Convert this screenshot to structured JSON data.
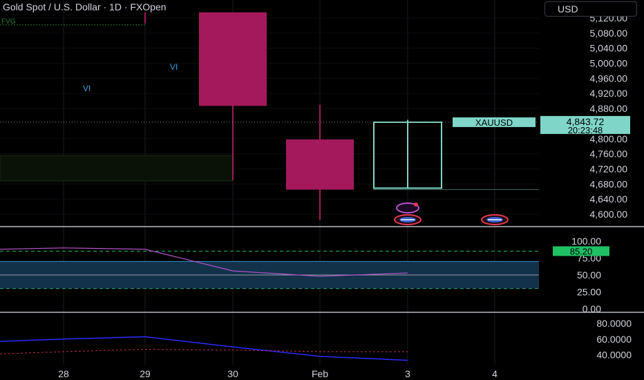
{
  "header": {
    "title": "Gold Spot / U.S. Dollar · 1D · FXOpen",
    "currency": "USD",
    "fvg_label": "FVG"
  },
  "colors": {
    "background": "#000000",
    "bear_candle": "#a3195b",
    "bull_candle_outline": "#7fd6c8",
    "rsi_line": "#b455c9",
    "rsi_band": "#12324a",
    "rsi_level": "#20c065",
    "second_line": "#2b2bff",
    "second_dashed": "#c0304a",
    "text": "#d1d4dc",
    "grid": "#1a1c22"
  },
  "chart_data": [
    {
      "type": "candlestick",
      "title": "Gold Spot / U.S. Dollar · 1D · FXOpen",
      "symbol": "XAUUSD",
      "x_ticks": [
        "28",
        "29",
        "30",
        "Feb",
        "3",
        "4"
      ],
      "y_ticks": [
        "5,120.00",
        "5,080.00",
        "5,040.00",
        "5,000.00",
        "4,960.00",
        "4,920.00",
        "4,880.00",
        "4,800.00",
        "4,760.00",
        "4,720.00",
        "4,680.00",
        "4,640.00",
        "4,600.00"
      ],
      "ylim": [
        4585,
        5135
      ],
      "candles": [
        {
          "x": "29",
          "open": 5135,
          "high": 5135,
          "low": 5105,
          "close": 5105,
          "direction": "down"
        },
        {
          "x": "30",
          "open": 5135,
          "high": 5135,
          "low": 4690,
          "close": 4887,
          "direction": "down"
        },
        {
          "x": "Feb",
          "open": 4798,
          "high": 4890,
          "low": 4585,
          "close": 4665,
          "direction": "down"
        },
        {
          "x": "3",
          "open": 4669,
          "high": 4850,
          "low": 4669,
          "close": 4843.72,
          "direction": "up"
        }
      ],
      "last_price": {
        "label": "XAUUSD",
        "price": "4,843.72",
        "countdown": "20:23:48"
      },
      "annotations": [
        {
          "text": "VI",
          "x": "28"
        },
        {
          "text": "VI",
          "x": "29"
        }
      ]
    },
    {
      "type": "line",
      "indicator": "RSI",
      "y_ticks": [
        "100.00",
        "75.00",
        "50.00",
        "25.00",
        "0.00"
      ],
      "ylim": [
        0,
        100
      ],
      "levels": [
        85.2,
        70,
        50,
        30
      ],
      "current_value": "85.20",
      "x": [
        "28",
        "29",
        "30",
        "Feb",
        "3"
      ],
      "series": [
        {
          "values": [
            90,
            88,
            56,
            48,
            53
          ]
        }
      ]
    },
    {
      "type": "line",
      "y_ticks": [
        "80.0000",
        "60.0000",
        "40.0000"
      ],
      "ylim": [
        30,
        90
      ],
      "x": [
        "28",
        "29",
        "30",
        "Feb",
        "3"
      ],
      "series": [
        {
          "values": [
            60,
            63,
            50,
            38,
            33
          ]
        },
        {
          "values": [
            44,
            47,
            46,
            44,
            44
          ]
        }
      ]
    }
  ]
}
